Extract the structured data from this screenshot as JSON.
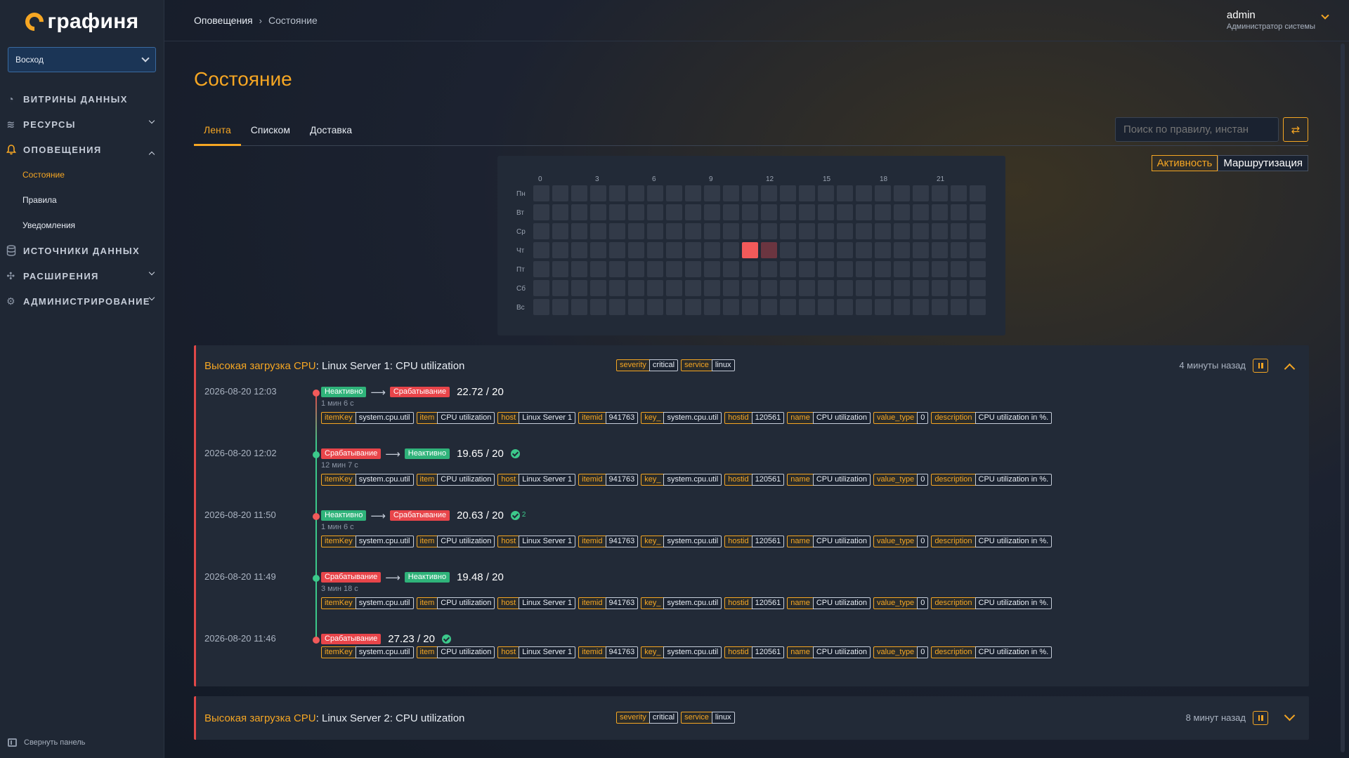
{
  "brand": {
    "name": "графиня"
  },
  "org_select": {
    "value": "Восход"
  },
  "nav": {
    "items": [
      {
        "label": "ВИТРИНЫ ДАННЫХ",
        "icon": "gauge-icon"
      },
      {
        "label": "РЕСУРСЫ",
        "icon": "layers-icon"
      },
      {
        "label": "ОПОВЕЩЕНИЯ",
        "icon": "bell-icon"
      },
      {
        "label": "ИСТОЧНИКИ ДАННЫХ",
        "icon": "database-icon"
      },
      {
        "label": "РАСШИРЕНИЯ",
        "icon": "puzzle-icon"
      },
      {
        "label": "АДМИНИСТРИРОВАНИЕ",
        "icon": "gear-icon"
      }
    ],
    "sub_items": [
      "Состояние",
      "Правила",
      "Уведомления"
    ],
    "collapse_label": "Свернуть панель"
  },
  "breadcrumb": {
    "parent": "Оповещения",
    "sep": "›",
    "current": "Состояние"
  },
  "user": {
    "name": "admin",
    "role": "Администратор системы"
  },
  "page": {
    "title": "Состояние"
  },
  "tabs": [
    "Лента",
    "Списком",
    "Доставка"
  ],
  "search": {
    "placeholder": "Поиск по правилу, инстан"
  },
  "mode_switch": {
    "active": "Активность",
    "other": "Маршрутизация"
  },
  "heatmap": {
    "hour_labels": [
      "0",
      "3",
      "6",
      "9",
      "12",
      "15",
      "18",
      "21"
    ],
    "day_labels": [
      "Пн",
      "Вт",
      "Ср",
      "Чт",
      "Пт",
      "Сб",
      "Вс"
    ],
    "hot_cells": [
      {
        "day": 3,
        "hour": 11,
        "level": "high"
      },
      {
        "day": 3,
        "hour": 12,
        "level": "low"
      }
    ],
    "colors": {
      "empty": "#323a48",
      "high": "#f25a5a",
      "low": "#6b3540"
    }
  },
  "tag_keys": {
    "severity": "severity",
    "service": "service",
    "itemKey": "itemKey",
    "item": "item",
    "host": "host",
    "itemid": "itemid",
    "key": "key_",
    "hostid": "hostid",
    "name": "name",
    "value_type": "value_type",
    "description": "description"
  },
  "states": {
    "inactive": "Неактивно",
    "firing": "Срабатывание"
  },
  "alert1": {
    "title_highlight": "Высокая загрузка CPU",
    "title_rest": ": Linux Server 1: CPU utilization",
    "severity": "critical",
    "service": "linux",
    "ago": "4 минуты назад",
    "labels": {
      "itemKey": "system.cpu.util",
      "item": "CPU utilization",
      "host": "Linux Server 1",
      "itemid": "941763",
      "key": "system.cpu.util",
      "hostid": "120561",
      "name": "CPU utilization",
      "value_type": "0",
      "description": "CPU utilization in %."
    },
    "events": [
      {
        "time": "2026-08-20 12:03",
        "value": "22.72 / 20",
        "duration": "1 мин 6 с"
      },
      {
        "time": "2026-08-20 12:02",
        "value": "19.65 / 20",
        "duration": "12 мин 7 с"
      },
      {
        "time": "2026-08-20 11:50",
        "value": "20.63 / 20",
        "duration": "1 мин 6 с",
        "check_count": "2"
      },
      {
        "time": "2026-08-20 11:49",
        "value": "19.48 / 20",
        "duration": "3 мин 18 с"
      },
      {
        "time": "2026-08-20 11:46",
        "value": "27.23 / 20"
      }
    ]
  },
  "alert2": {
    "title_highlight": "Высокая загрузка CPU",
    "title_rest": ": Linux Server 2: CPU utilization",
    "severity": "critical",
    "service": "linux",
    "ago": "8 минут назад"
  },
  "colors": {
    "accent": "#f5a623",
    "firing": "#e8454a",
    "inactive": "#2fb37a"
  }
}
